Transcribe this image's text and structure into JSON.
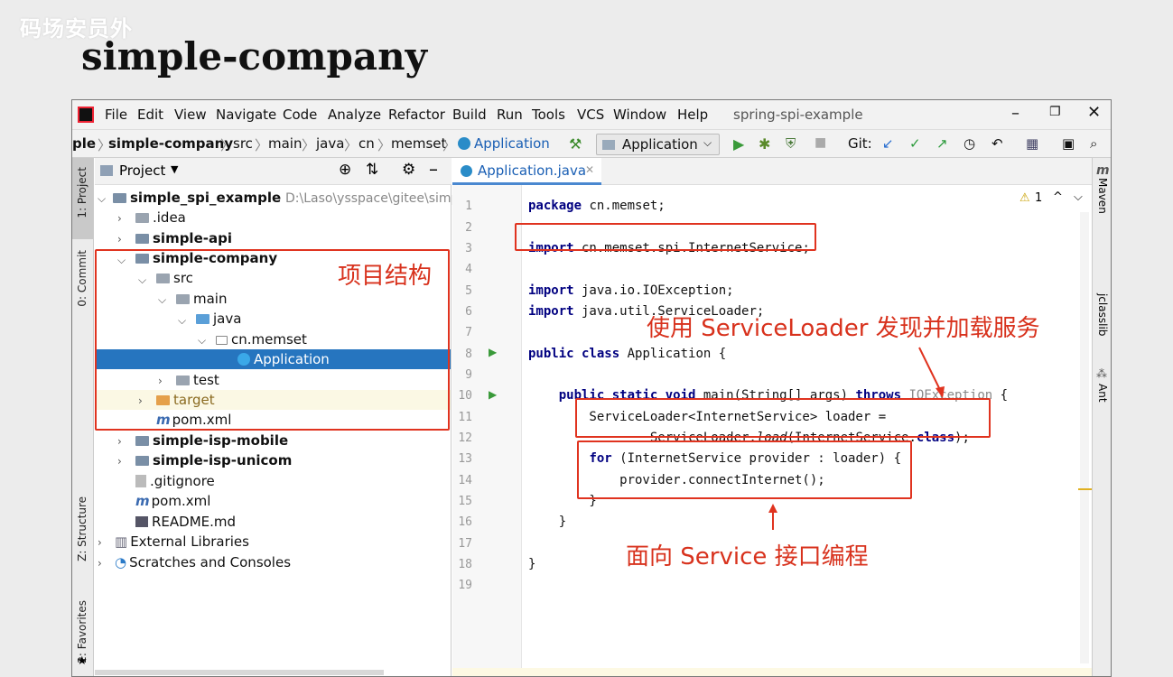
{
  "slide": {
    "watermark": "码场安员外",
    "title": "simple-company"
  },
  "menubar": {
    "items": [
      "File",
      "Edit",
      "View",
      "Navigate",
      "Code",
      "Analyze",
      "Refactor",
      "Build",
      "Run",
      "Tools",
      "VCS",
      "Window",
      "Help"
    ],
    "project_title": "spring-spi-example"
  },
  "breadcrumb": {
    "items": [
      "ple",
      "simple-company",
      "src",
      "main",
      "java",
      "cn",
      "memset",
      "Application"
    ],
    "run_config": "Application",
    "git_label": "Git:"
  },
  "sidebar_tabs": {
    "project": "1: Project",
    "commit": "0: Commit",
    "structure": "Z: Structure",
    "favorites": "2: Favorites"
  },
  "project_panel": {
    "title": "Project",
    "tree": [
      {
        "label": "simple_spi_example",
        "path": "D:\\Laso\\ysspace\\gitee\\simple_"
      },
      {
        "label": ".idea"
      },
      {
        "label": "simple-api"
      },
      {
        "label": "simple-company"
      },
      {
        "label": "src"
      },
      {
        "label": "main"
      },
      {
        "label": "java"
      },
      {
        "label": "cn.memset"
      },
      {
        "label": "Application"
      },
      {
        "label": "test"
      },
      {
        "label": "target"
      },
      {
        "label": "pom.xml"
      },
      {
        "label": "simple-isp-mobile"
      },
      {
        "label": "simple-isp-unicom"
      },
      {
        "label": ".gitignore"
      },
      {
        "label": "pom.xml"
      },
      {
        "label": "README.md"
      },
      {
        "label": "External Libraries"
      },
      {
        "label": "Scratches and Consoles"
      }
    ]
  },
  "editor": {
    "tab": "Application.java",
    "warning_count": "1",
    "line_numbers": [
      "1",
      "2",
      "3",
      "4",
      "5",
      "6",
      "7",
      "8",
      "9",
      "10",
      "11",
      "12",
      "13",
      "14",
      "15",
      "16",
      "17",
      "18",
      "19"
    ]
  },
  "right_tabs": {
    "maven": "Maven",
    "jclasslib": "jclasslib",
    "ant": "Ant"
  },
  "annotations": {
    "structure": "项目结构",
    "serviceloader": "使用 ServiceLoader 发现并加载服务",
    "interface": "面向 Service 接口编程"
  }
}
